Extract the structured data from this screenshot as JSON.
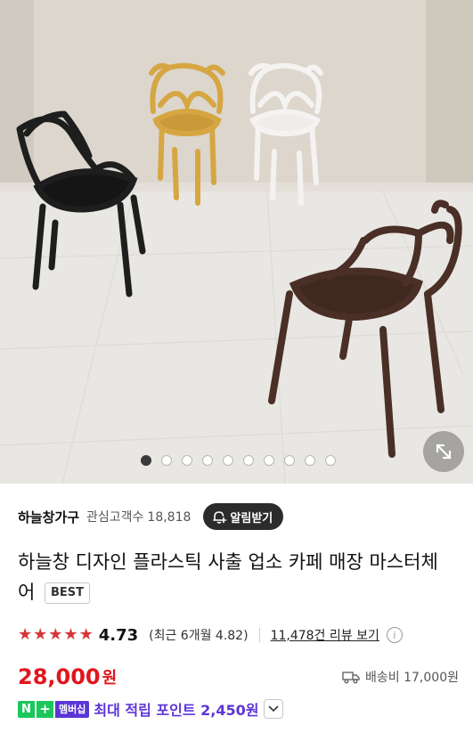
{
  "gallery": {
    "image_alt": "하늘창 디자인 플라스틱 사출 업소 카페 매장 마스터체어",
    "slide_count": 10,
    "active_slide": 1
  },
  "store": {
    "name": "하늘창가구",
    "followers_label": "관심고객수",
    "followers_count": "18,818",
    "alarm_label": "알림받기"
  },
  "product": {
    "title": "하늘창 디자인 플라스틱 사출 업소 카페 매장 마스터체어",
    "badge": "BEST"
  },
  "rating": {
    "stars": 5,
    "value": "4.73",
    "recent": "(최근 6개월 4.82)",
    "reviews_link": "11,478건 리뷰 보기",
    "info_icon": "i"
  },
  "price": {
    "amount": "28,000",
    "currency": "원",
    "shipping": "배송비 17,000원"
  },
  "points": {
    "n_badge": "N",
    "plus_badge": "+",
    "member_badge": "멤버십",
    "text": "최대 적립 포인트 2,450원"
  },
  "colors": {
    "accent_red": "#e0161d",
    "star_red": "#d6353b",
    "naver_green": "#19c75b",
    "membership_purple": "#5b36d6",
    "dark_button": "#2c2c2c"
  },
  "icons": {
    "alarm": "bell-plus-icon",
    "expand": "expand-diagonal-icon",
    "shipping": "truck-icon",
    "chevron": "chevron-down-icon",
    "info": "info-icon"
  }
}
